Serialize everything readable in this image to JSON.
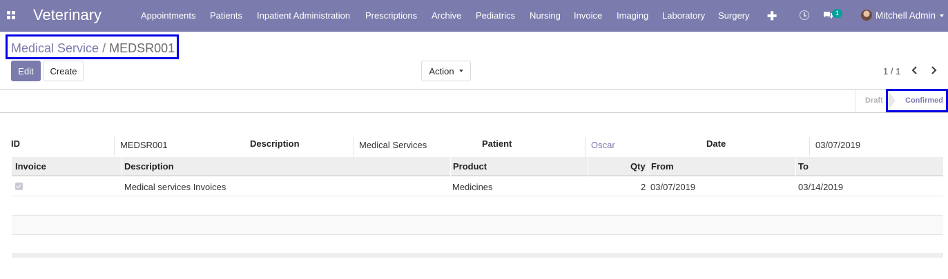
{
  "navbar": {
    "app_title": "Veterinary",
    "menu": [
      "Appointments",
      "Patients",
      "Inpatient Administration",
      "Prescriptions",
      "Archive",
      "Pediatrics",
      "Nursing",
      "Invoice",
      "Imaging",
      "Laboratory",
      "Surgery"
    ],
    "chat_badge": "1",
    "user_name": "Mitchell Admin",
    "icons": [
      "apps-grid-icon",
      "plus-icon",
      "clock-icon",
      "chat-icon",
      "avatar",
      "caret-down-icon"
    ],
    "bg_color": "#7c7bad"
  },
  "breadcrumb": {
    "parent": "Medical Service",
    "separator": "/",
    "current": "MEDSR001"
  },
  "toolbar": {
    "edit_label": "Edit",
    "create_label": "Create",
    "action_label": "Action",
    "pager": "1 / 1"
  },
  "status": {
    "states": [
      "Draft",
      "Confirmed"
    ],
    "active": "Confirmed"
  },
  "form": {
    "id_label": "ID",
    "id_value": "MEDSR001",
    "description_label": "Description",
    "description_value": "Medical Services",
    "patient_label": "Patient",
    "patient_value": "Oscar",
    "date_label": "Date",
    "date_value": "03/07/2019"
  },
  "table": {
    "columns": [
      "Invoice",
      "Description",
      "Product",
      "Qty",
      "From",
      "To"
    ],
    "rows": [
      {
        "invoice_checked": true,
        "description": "Medical services Invoices",
        "product": "Medicines",
        "qty": "2",
        "from": "03/07/2019",
        "to": "03/14/2019"
      }
    ]
  }
}
